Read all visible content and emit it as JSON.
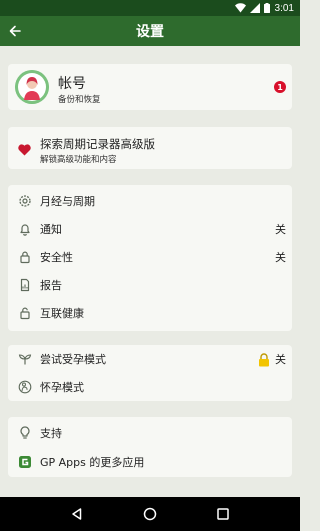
{
  "status_bar": {
    "time": "3:01"
  },
  "app_bar": {
    "title": "设置"
  },
  "account": {
    "title": "帐号",
    "subtitle": "备份和恢复",
    "badge": "1"
  },
  "premium": {
    "title": "探索周期记录器高级版",
    "subtitle": "解锁高级功能和内容"
  },
  "settings": {
    "items": [
      {
        "label": "月经与周期",
        "icon": "gear-icon",
        "value": ""
      },
      {
        "label": "通知",
        "icon": "bell-icon",
        "value": "关"
      },
      {
        "label": "安全性",
        "icon": "lock-icon",
        "value": "关"
      },
      {
        "label": "报告",
        "icon": "report-icon",
        "value": ""
      },
      {
        "label": "互联健康",
        "icon": "sync-lock-icon",
        "value": ""
      }
    ]
  },
  "pregnancy": {
    "items": [
      {
        "label": "尝试受孕模式",
        "icon": "sprout-icon",
        "value": "关"
      },
      {
        "label": "怀孕模式",
        "icon": "pregnant-icon",
        "value": ""
      }
    ]
  },
  "support": {
    "items": [
      {
        "label": "支持",
        "icon": "bulb-icon"
      },
      {
        "label": "GP Apps 的更多应用",
        "icon": "gp-logo-icon"
      }
    ]
  },
  "colors": {
    "app_bar": "#2e6b2d",
    "status_bar": "#1b4c1d",
    "background": "#e9ebe4",
    "card": "#f7f8f4",
    "badge": "#d8102b",
    "heart": "#c8182f",
    "lock_accent": "#f2c400"
  }
}
